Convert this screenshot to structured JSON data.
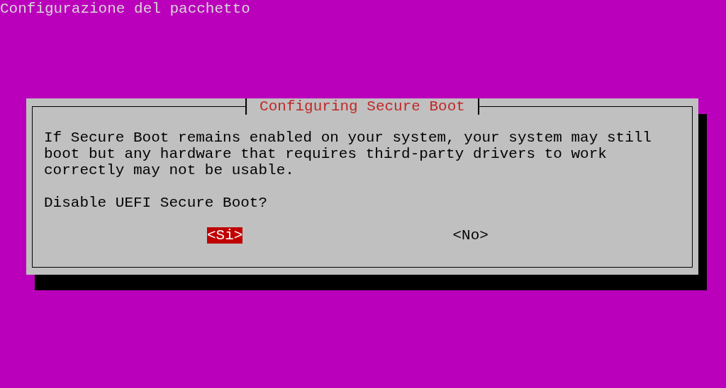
{
  "screen_title": "Configurazione del pacchetto",
  "dialog": {
    "title": "Configuring Secure Boot",
    "message_lines": [
      "If Secure Boot remains enabled on your system, your system may still",
      "boot but any hardware that requires third-party drivers to work",
      "correctly may not be usable."
    ],
    "question": "Disable UEFI Secure Boot?",
    "buttons": [
      {
        "label": "<Si>",
        "selected": true
      },
      {
        "label": "<No>",
        "selected": false
      }
    ]
  }
}
